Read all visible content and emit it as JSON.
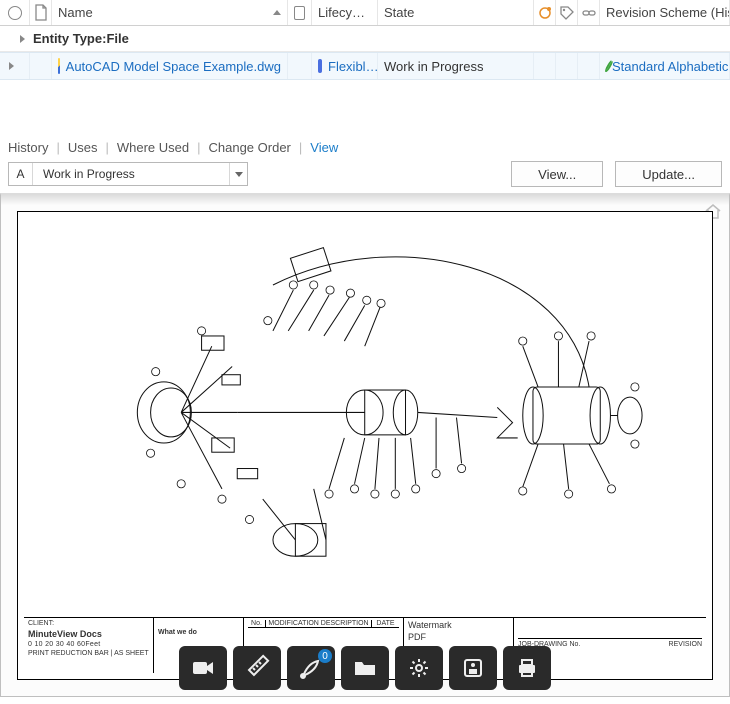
{
  "grid": {
    "headers": {
      "name": "Name",
      "lifecycle": "Lifecy…",
      "state": "State",
      "revision": "Revision Scheme (Hist…"
    },
    "group_label_prefix": "Entity Type:",
    "group_label_value": "File",
    "row": {
      "filename": "AutoCAD Model Space Example.dwg",
      "lifecycle": "Flexibl…",
      "state": "Work in Progress",
      "revision": "Standard Alphabetic For…"
    }
  },
  "tabs": {
    "items": [
      "History",
      "Uses",
      "Where Used",
      "Change Order",
      "View"
    ],
    "active_index": 4
  },
  "toolbar": {
    "code": "A",
    "label": "Work in Progress",
    "view_btn": "View...",
    "update_btn": "Update..."
  },
  "titleblock": {
    "left_top": "CLIENT:",
    "left_main": "MinuteView Docs",
    "scale_row": "0        10       20       30       40     60Feet",
    "scale_sub": "PRINT REDUCTION BAR | AS SHEET",
    "mid_label": "What we do",
    "mod_label": "MODIFICATION DESCRIPTION",
    "mod_no": "No.",
    "mod_date": "DATE",
    "wm_label": "Watermark",
    "wm_value": "PDF",
    "job": "JOB-DRAWING No.",
    "rev": "REVISION"
  },
  "floatbar": {
    "badge": "0"
  }
}
